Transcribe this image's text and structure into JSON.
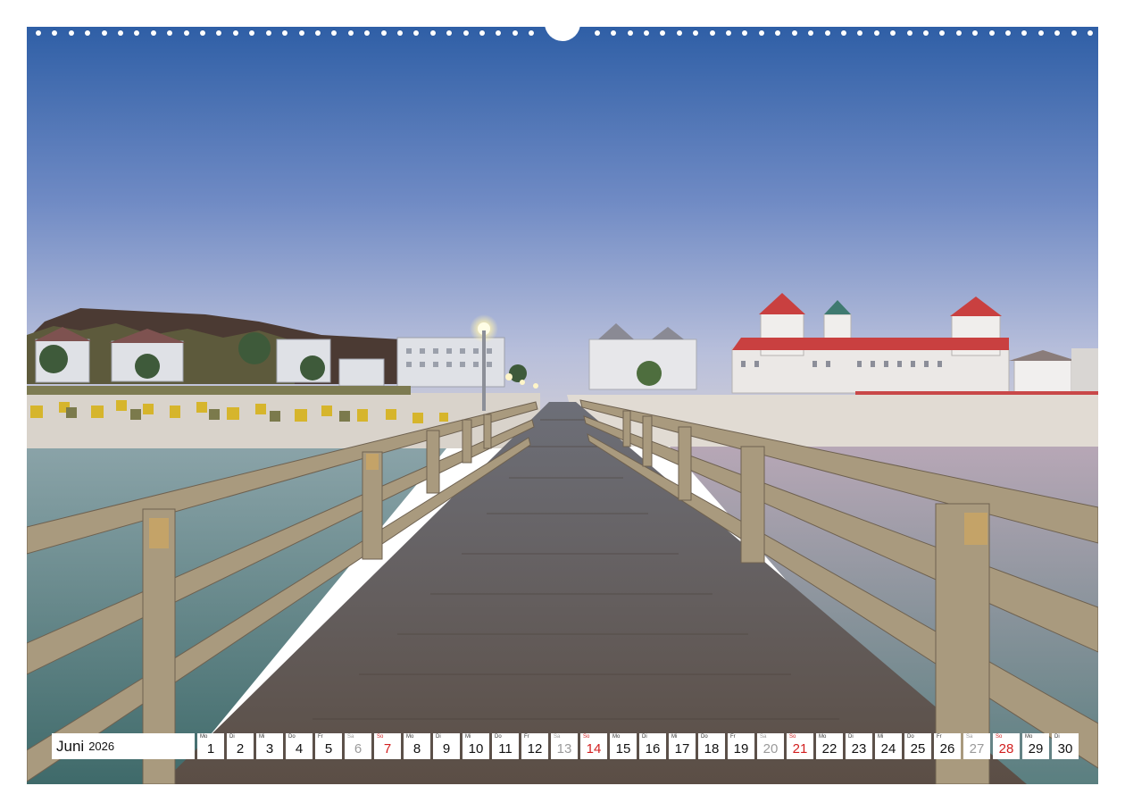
{
  "calendar": {
    "month": "Juni",
    "year": "2026",
    "days": [
      {
        "wd": "Mo",
        "num": "1",
        "kind": "weekday"
      },
      {
        "wd": "Di",
        "num": "2",
        "kind": "weekday"
      },
      {
        "wd": "Mi",
        "num": "3",
        "kind": "weekday"
      },
      {
        "wd": "Do",
        "num": "4",
        "kind": "weekday"
      },
      {
        "wd": "Fr",
        "num": "5",
        "kind": "weekday"
      },
      {
        "wd": "Sa",
        "num": "6",
        "kind": "sat"
      },
      {
        "wd": "So",
        "num": "7",
        "kind": "sun"
      },
      {
        "wd": "Mo",
        "num": "8",
        "kind": "weekday"
      },
      {
        "wd": "Di",
        "num": "9",
        "kind": "weekday"
      },
      {
        "wd": "Mi",
        "num": "10",
        "kind": "weekday"
      },
      {
        "wd": "Do",
        "num": "11",
        "kind": "weekday"
      },
      {
        "wd": "Fr",
        "num": "12",
        "kind": "weekday"
      },
      {
        "wd": "Sa",
        "num": "13",
        "kind": "sat"
      },
      {
        "wd": "So",
        "num": "14",
        "kind": "sun"
      },
      {
        "wd": "Mo",
        "num": "15",
        "kind": "weekday"
      },
      {
        "wd": "Di",
        "num": "16",
        "kind": "weekday"
      },
      {
        "wd": "Mi",
        "num": "17",
        "kind": "weekday"
      },
      {
        "wd": "Do",
        "num": "18",
        "kind": "weekday"
      },
      {
        "wd": "Fr",
        "num": "19",
        "kind": "weekday"
      },
      {
        "wd": "Sa",
        "num": "20",
        "kind": "sat"
      },
      {
        "wd": "So",
        "num": "21",
        "kind": "sun"
      },
      {
        "wd": "Mo",
        "num": "22",
        "kind": "weekday"
      },
      {
        "wd": "Di",
        "num": "23",
        "kind": "weekday"
      },
      {
        "wd": "Mi",
        "num": "24",
        "kind": "weekday"
      },
      {
        "wd": "Do",
        "num": "25",
        "kind": "weekday"
      },
      {
        "wd": "Fr",
        "num": "26",
        "kind": "weekday"
      },
      {
        "wd": "Sa",
        "num": "27",
        "kind": "sat"
      },
      {
        "wd": "So",
        "num": "28",
        "kind": "sun"
      },
      {
        "wd": "Mo",
        "num": "29",
        "kind": "weekday"
      },
      {
        "wd": "Di",
        "num": "30",
        "kind": "weekday"
      }
    ]
  },
  "colors": {
    "sunday": "#d21f1f",
    "saturday": "#9a9a9a",
    "sky_top": "#2f5fa6",
    "sky_horizon": "#c9c9d8"
  },
  "photo": {
    "icon": "pier-seaside-photo"
  }
}
